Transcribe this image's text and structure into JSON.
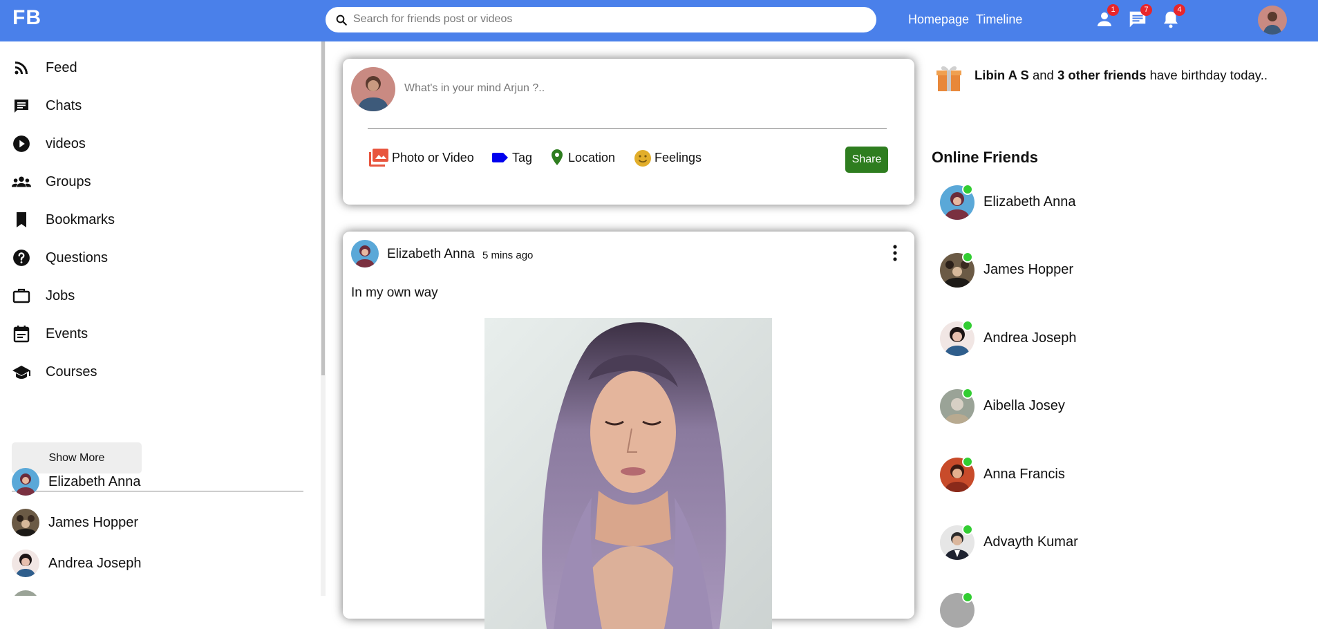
{
  "topbar": {
    "logo": "FB",
    "search_placeholder": "Search for friends post or videos",
    "links": [
      "Homepage",
      "Timeline"
    ],
    "badges": {
      "friends": "1",
      "messages": "7",
      "notifications": "4"
    },
    "icons": [
      "search-icon",
      "person-icon",
      "chat-icon",
      "bell-icon"
    ],
    "brand_color": "#4a80ea",
    "badge_color": "#e8262b"
  },
  "sidebar": {
    "items": [
      {
        "label": "Feed",
        "icon": "rss-feed-icon"
      },
      {
        "label": "Chats",
        "icon": "chat-icon"
      },
      {
        "label": "videos",
        "icon": "play-circle-icon"
      },
      {
        "label": "Groups",
        "icon": "group-icon"
      },
      {
        "label": "Bookmarks",
        "icon": "bookmark-icon"
      },
      {
        "label": "Questions",
        "icon": "help-circle-icon"
      },
      {
        "label": "Jobs",
        "icon": "briefcase-icon"
      },
      {
        "label": "Events",
        "icon": "calendar-icon"
      },
      {
        "label": "Courses",
        "icon": "school-icon"
      }
    ],
    "show_more": "Show More",
    "friends": [
      "Elizabeth Anna",
      "James Hopper",
      "Andrea Joseph"
    ]
  },
  "share": {
    "placeholder": "What's in your mind Arjun ?..",
    "options": [
      {
        "label": "Photo or Video",
        "icon": "photo-library-icon",
        "color": "#e8553e"
      },
      {
        "label": "Tag",
        "icon": "tag-label-icon",
        "color": "#0000ee"
      },
      {
        "label": "Location",
        "icon": "location-pin-icon",
        "color": "#2e7d1f"
      },
      {
        "label": "Feelings",
        "icon": "smiley-icon",
        "color": "#e2ae2b"
      }
    ],
    "share_label": "Share",
    "share_color": "#2e7d1f"
  },
  "post": {
    "author": "Elizabeth Anna",
    "time": "5 mins ago",
    "text": "In my own way"
  },
  "birthday": {
    "name": "Libin A S",
    "and": "and",
    "others": "3 other friends",
    "suffix": "have birthday today.."
  },
  "online": {
    "title": "Online Friends",
    "friends": [
      "Elizabeth Anna",
      "James Hopper",
      "Andrea Joseph",
      "Aibella Josey",
      "Anna Francis",
      "Advayth Kumar"
    ],
    "status_color": "#32cd32"
  }
}
